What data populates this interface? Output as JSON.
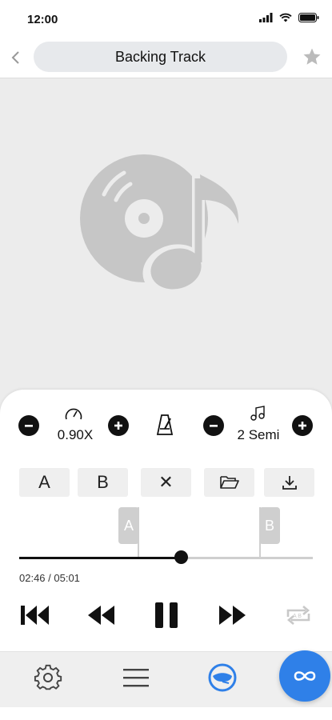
{
  "status_bar": {
    "time": "12:00",
    "icons": [
      "signal-icon",
      "wifi-icon",
      "battery-icon"
    ]
  },
  "header": {
    "title": "Backing Track",
    "back_icon": "chevron-left-icon",
    "favorite_icon": "star-icon"
  },
  "controls": {
    "speed_value": "0.90X",
    "speed_icon": "speedometer-icon",
    "metronome_icon": "metronome-icon",
    "pitch_value": "2 Semi",
    "pitch_icon": "music-note-icon"
  },
  "loop_buttons": {
    "a_label": "A",
    "b_label": "B",
    "clear_label": "✕"
  },
  "markers": {
    "a_label": "A",
    "b_label": "B"
  },
  "playback": {
    "time": "02:46 / 05:01",
    "progress": 0.55
  },
  "colors": {
    "accent": "#2f80e8",
    "icon_gray": "#c6c6c6"
  }
}
